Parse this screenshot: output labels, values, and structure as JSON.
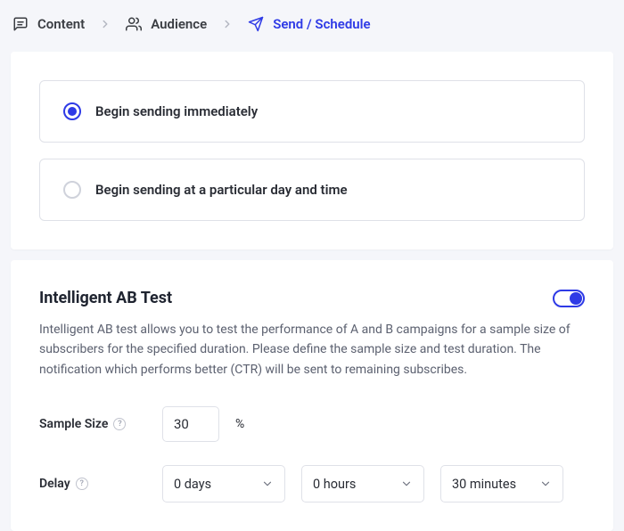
{
  "breadcrumb": {
    "content": "Content",
    "audience": "Audience",
    "send": "Send / Schedule"
  },
  "sendOptions": {
    "immediate": "Begin sending immediately",
    "scheduled": "Begin sending at a particular day and time"
  },
  "abTest": {
    "title": "Intelligent AB Test",
    "desc": "Intelligent AB test allows you to test the performance of A and B campaigns for a sample size of subscribers for the specified duration. Please define the sample size and test duration. The notification which performs better (CTR) will be sent to remaining subscribes.",
    "sampleLabel": "Sample Size",
    "sampleValue": "30",
    "sampleUnit": "%",
    "delayLabel": "Delay",
    "delayDays": "0 days",
    "delayHours": "0 hours",
    "delayMinutes": "30 minutes"
  }
}
